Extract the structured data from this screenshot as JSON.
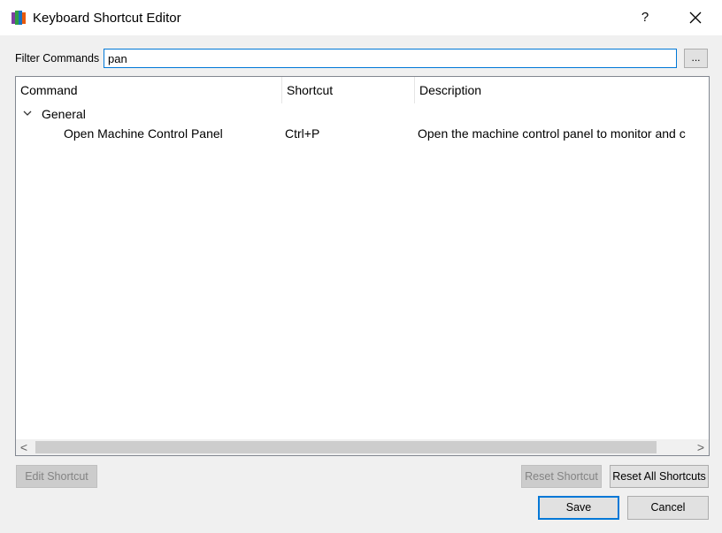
{
  "window": {
    "title": "Keyboard Shortcut Editor",
    "help_label": "?",
    "close_label": "✕"
  },
  "filter": {
    "label": "Filter Commands",
    "value": "pan",
    "browse_label": "..."
  },
  "tree": {
    "columns": [
      "Command",
      "Shortcut",
      "Description"
    ],
    "groups": [
      {
        "name": "General",
        "expanded": true,
        "items": [
          {
            "command": "Open Machine Control Panel",
            "shortcut": "Ctrl+P",
            "description": "Open the machine control panel to monitor and c"
          }
        ]
      }
    ]
  },
  "scroll": {
    "left_arrow": "<",
    "right_arrow": ">"
  },
  "buttons": {
    "edit_shortcut": "Edit Shortcut",
    "reset_shortcut": "Reset Shortcut",
    "reset_all": "Reset All Shortcuts",
    "save": "Save",
    "cancel": "Cancel"
  }
}
